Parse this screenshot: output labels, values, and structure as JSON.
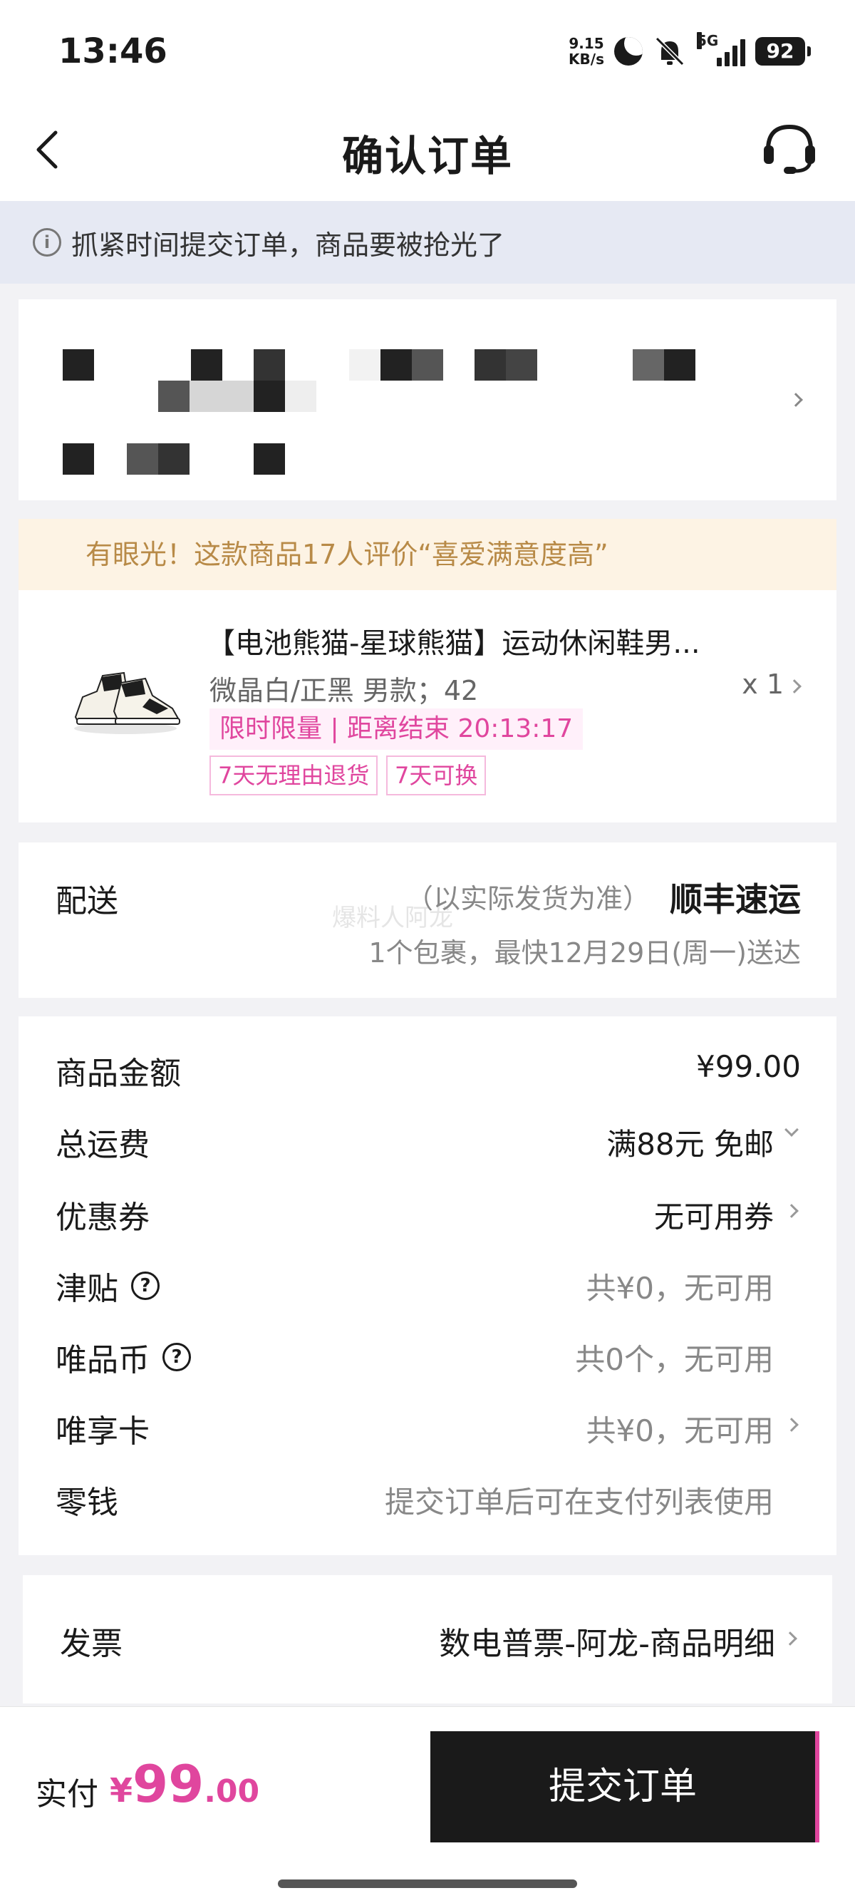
{
  "status_bar": {
    "time": "13:46",
    "net_speed_value": "9.15",
    "net_speed_unit": "KB/s",
    "network_type": "5G",
    "battery": "92"
  },
  "nav": {
    "title": "确认订单",
    "back_icon": "back-chevron-icon",
    "service_icon": "headset-icon"
  },
  "notice": {
    "text": "抓紧时间提交订单，商品要被抢光了",
    "icon": "info-icon"
  },
  "address": {
    "redacted": true
  },
  "highlight": {
    "text": "有眼光！这款商品17人评价“喜爱满意度高”"
  },
  "product": {
    "title": "【电池熊猫-星球熊猫】运动休闲鞋男...",
    "spec": "微晶白/正黑 男款；42",
    "qty": "x 1",
    "timer": "限时限量 | 距离结束 20:13:17",
    "tags": [
      "7天无理由退货",
      "7天可换"
    ]
  },
  "delivery": {
    "label": "配送",
    "note": "（以实际发货为准）",
    "carrier": "顺丰速运",
    "eta": "1个包裹，最快12月29日(周一)送达",
    "watermark": "爆料人阿龙"
  },
  "fees": [
    {
      "label": "商品金额",
      "value": "¥99.00",
      "help": false,
      "chevron": "none",
      "tone": "dark"
    },
    {
      "label": "总运费",
      "value": "满88元 免邮",
      "help": false,
      "chevron": "down",
      "tone": "dark"
    },
    {
      "label": "优惠券",
      "value": "无可用券",
      "help": false,
      "chevron": "right",
      "tone": "dark"
    },
    {
      "label": "津贴",
      "value": "共¥0，无可用",
      "help": true,
      "chevron": "none",
      "tone": "gray"
    },
    {
      "label": "唯品币",
      "value": "共0个，无可用",
      "help": true,
      "chevron": "none",
      "tone": "gray"
    },
    {
      "label": "唯享卡",
      "value": "共¥0，无可用",
      "help": false,
      "chevron": "right",
      "tone": "gray"
    },
    {
      "label": "零钱",
      "value": "提交订单后可在支付列表使用",
      "help": false,
      "chevron": "none",
      "tone": "gray"
    }
  ],
  "invoice": {
    "label": "发票",
    "value": "数电普票-阿龙-商品明细"
  },
  "bottom": {
    "pay_label": "实付",
    "currency": "¥",
    "amount_int": "99",
    "amount_dec": ".00",
    "submit_label": "提交订单"
  },
  "colors": {
    "accent": "#e0469e",
    "notice_bg": "#e6e9f3",
    "highlight_bg": "#fdf3e4",
    "highlight_text": "#b88a47"
  }
}
